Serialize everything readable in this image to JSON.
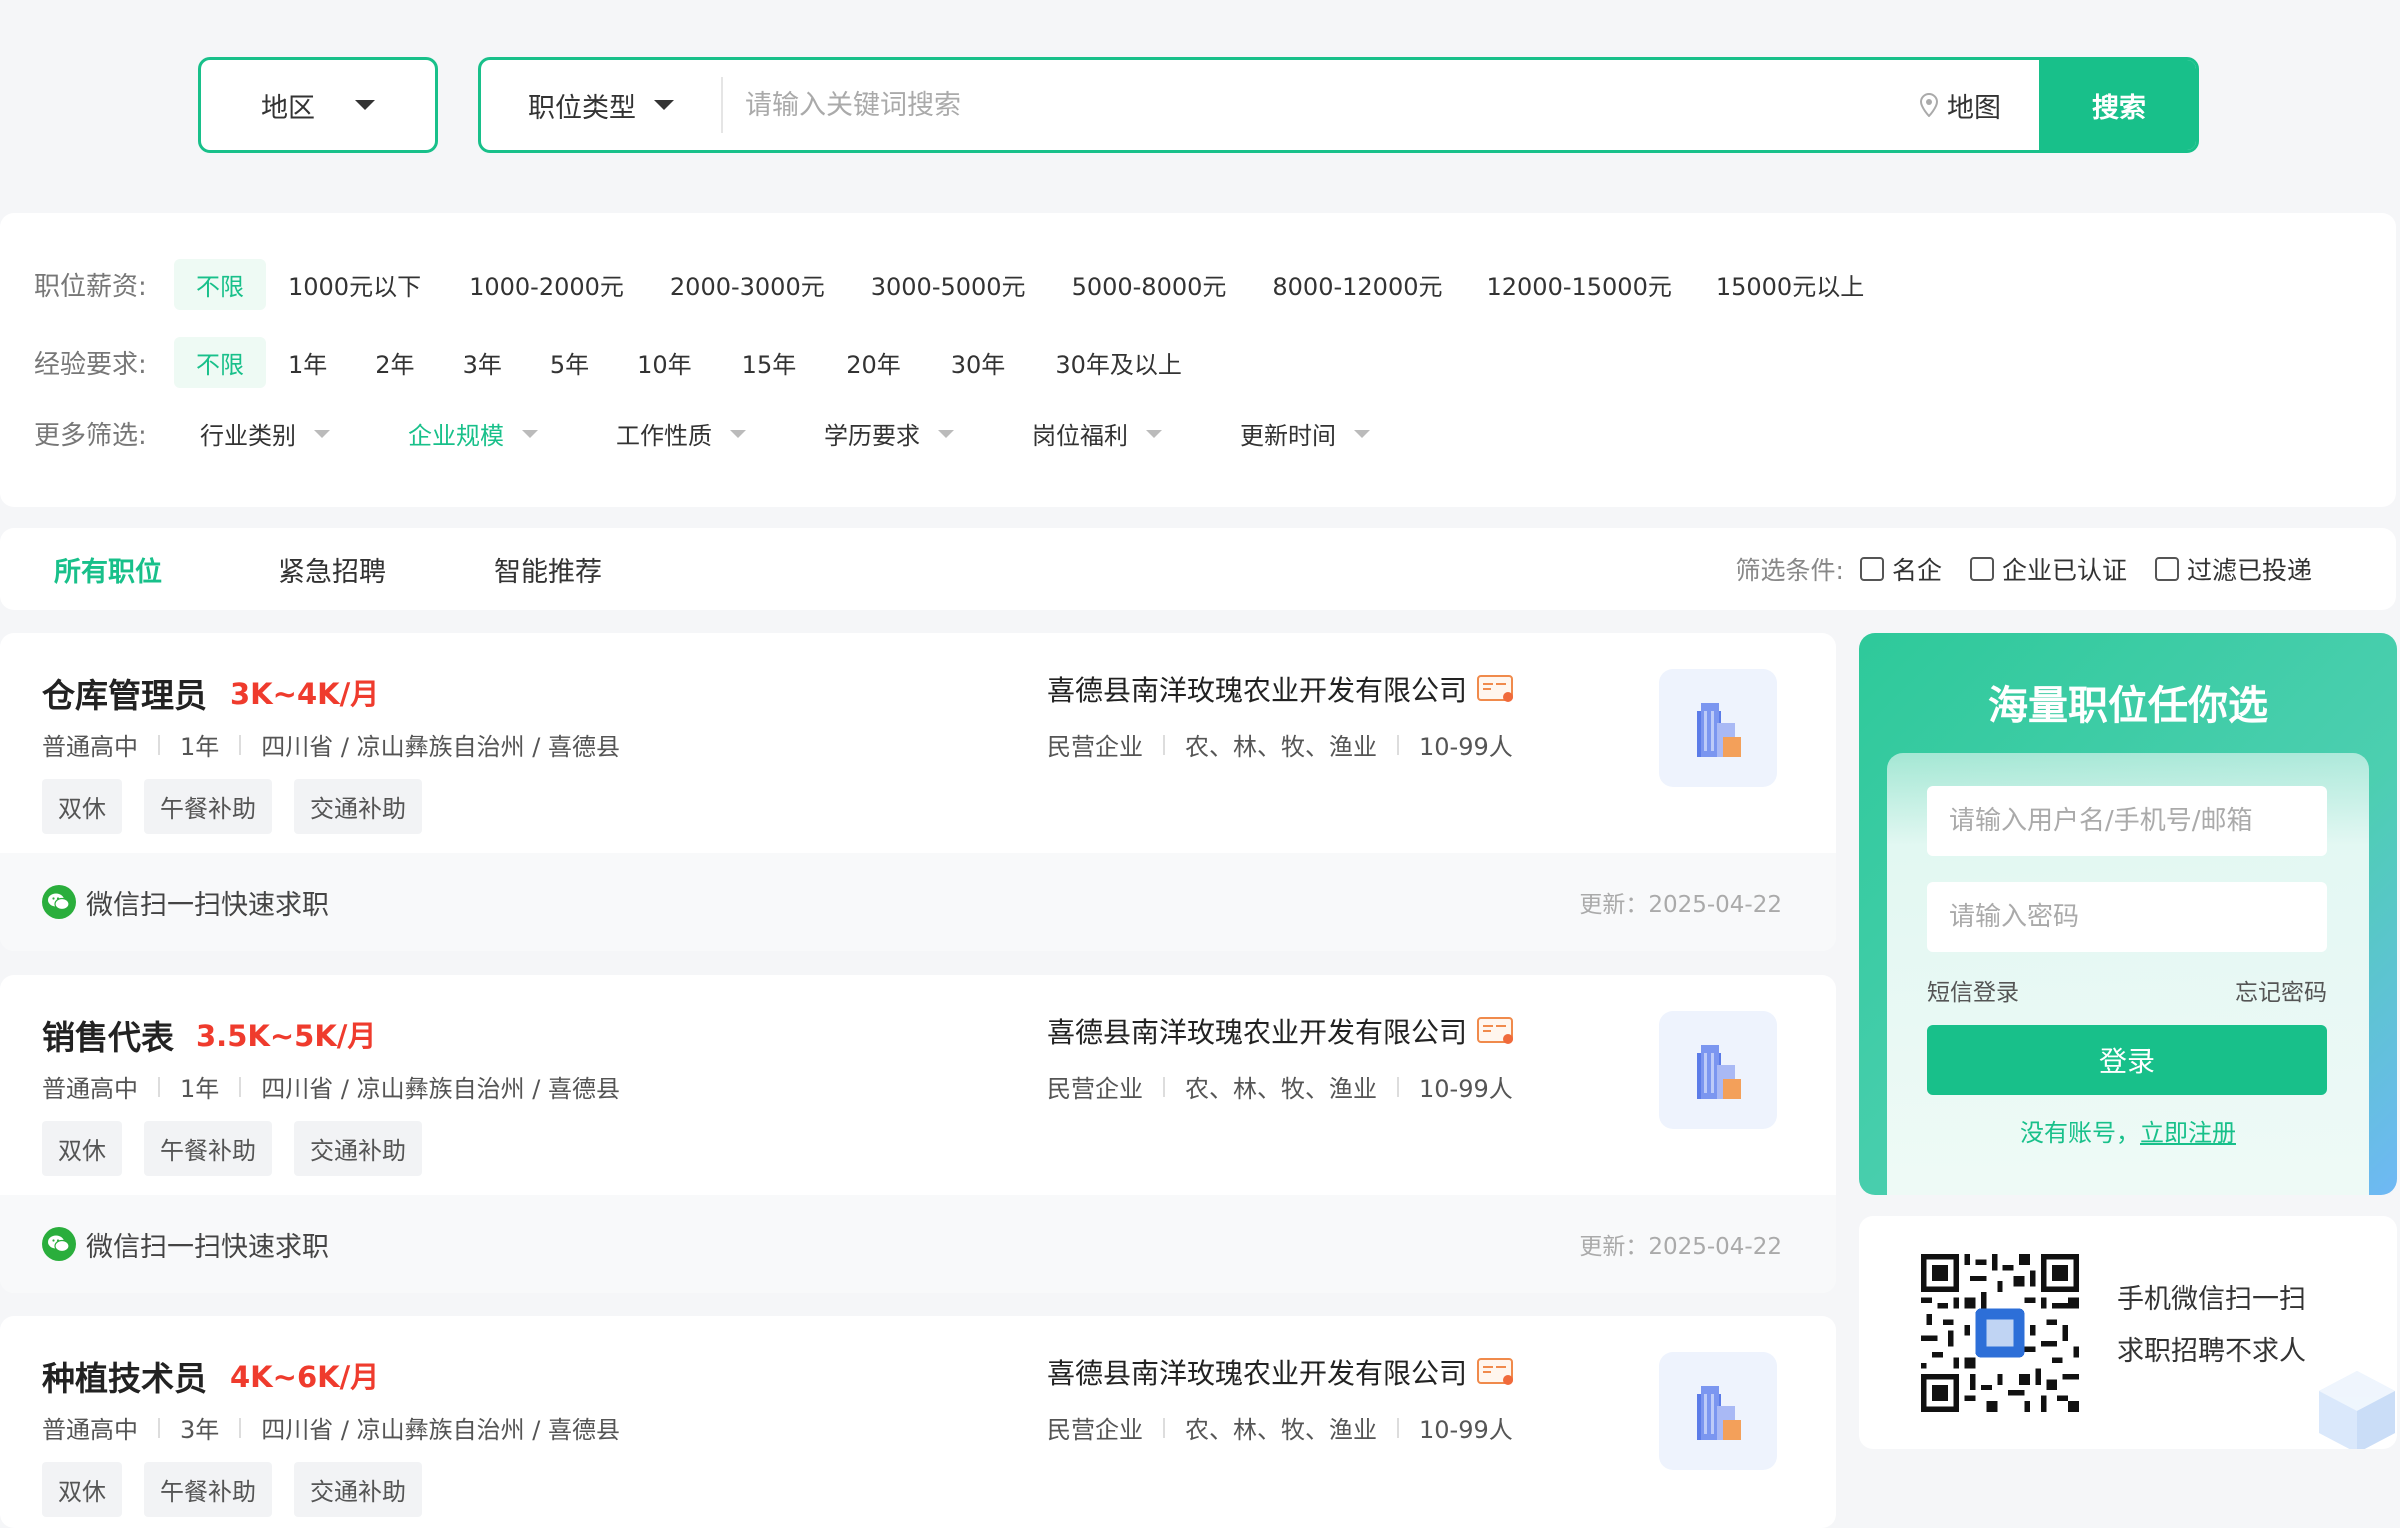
{
  "search": {
    "region_label": "地区",
    "jobtype_label": "职位类型",
    "keyword_placeholder": "请输入关键词搜索",
    "map_label": "地图",
    "search_button": "搜索"
  },
  "filters": {
    "salary": {
      "label": "职位薪资:",
      "options": [
        "不限",
        "1000元以下",
        "1000-2000元",
        "2000-3000元",
        "3000-5000元",
        "5000-8000元",
        "8000-12000元",
        "12000-15000元",
        "15000元以上"
      ],
      "active": "不限"
    },
    "experience": {
      "label": "经验要求:",
      "options": [
        "不限",
        "1年",
        "2年",
        "3年",
        "5年",
        "10年",
        "15年",
        "20年",
        "30年",
        "30年及以上"
      ],
      "active": "不限"
    },
    "more": {
      "label": "更多筛选:",
      "dropdowns": [
        "行业类别",
        "企业规模",
        "工作性质",
        "学历要求",
        "岗位福利",
        "更新时间"
      ],
      "active": "企业规模"
    }
  },
  "tabs": {
    "items": [
      "所有职位",
      "紧急招聘",
      "智能推荐"
    ],
    "active": "所有职位",
    "condition_label": "筛选条件:",
    "checkboxes": [
      "名企",
      "企业已认证",
      "过滤已投递"
    ]
  },
  "jobs": [
    {
      "title": "仓库管理员",
      "salary": "3K~4K/月",
      "education": "普通高中",
      "experience": "1年",
      "location": "四川省 / 凉山彝族自治州 / 喜德县",
      "tags": [
        "双休",
        "午餐补助",
        "交通补助"
      ],
      "company": "喜德县南洋玫瑰农业开发有限公司",
      "company_type": "民营企业",
      "industry": "农、林、牧、渔业",
      "size": "10-99人",
      "wechat_apply": "微信扫一扫快速求职",
      "updated": "更新：2025-04-22"
    },
    {
      "title": "销售代表",
      "salary": "3.5K~5K/月",
      "education": "普通高中",
      "experience": "1年",
      "location": "四川省 / 凉山彝族自治州 / 喜德县",
      "tags": [
        "双休",
        "午餐补助",
        "交通补助"
      ],
      "company": "喜德县南洋玫瑰农业开发有限公司",
      "company_type": "民营企业",
      "industry": "农、林、牧、渔业",
      "size": "10-99人",
      "wechat_apply": "微信扫一扫快速求职",
      "updated": "更新：2025-04-22"
    },
    {
      "title": "种植技术员",
      "salary": "4K~6K/月",
      "education": "普通高中",
      "experience": "3年",
      "location": "四川省 / 凉山彝族自治州 / 喜德县",
      "tags": [
        "双休",
        "午餐补助",
        "交通补助"
      ],
      "company": "喜德县南洋玫瑰农业开发有限公司",
      "company_type": "民营企业",
      "industry": "农、林、牧、渔业",
      "size": "10-99人"
    }
  ],
  "login": {
    "title": "海量职位任你选",
    "username_placeholder": "请输入用户名/手机号/邮箱",
    "password_placeholder": "请输入密码",
    "sms_login": "短信登录",
    "forgot_password": "忘记密码",
    "login_button": "登录",
    "no_account": "没有账号，",
    "register_link": "立即注册"
  },
  "qr": {
    "line1": "手机微信扫一扫",
    "line2": "求职招聘不求人"
  },
  "colors": {
    "accent": "#18c08a",
    "salary": "#ef3b2d",
    "background": "#f5f6f8"
  }
}
